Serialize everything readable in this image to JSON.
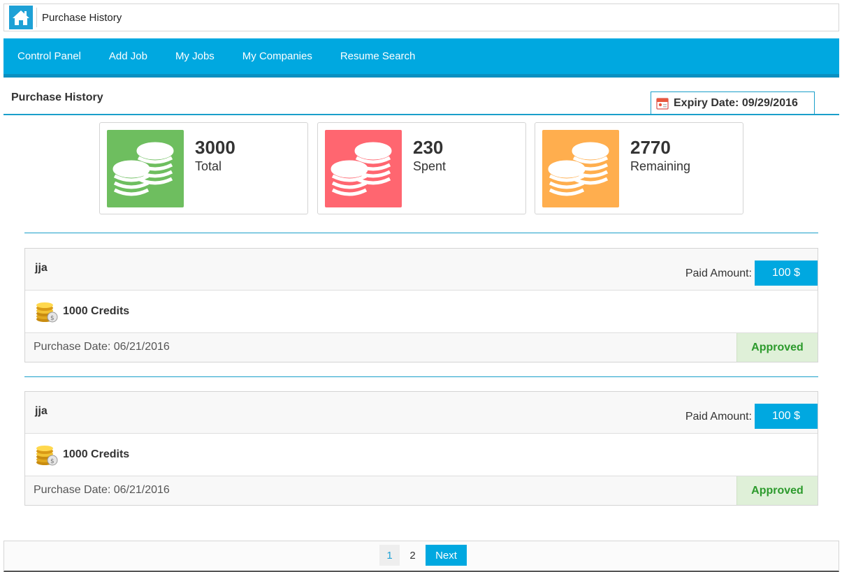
{
  "breadcrumb": {
    "home_icon": "home-icon",
    "current": "Purchase History"
  },
  "nav": {
    "items": [
      "Control Panel",
      "Add Job",
      "My Jobs",
      "My Companies",
      "Resume Search"
    ]
  },
  "page": {
    "title": "Purchase History",
    "expiry": "Expiry Date: 09/29/2016",
    "expiry_icon": "calendar-icon"
  },
  "stats": [
    {
      "value": "3000",
      "label": "Total",
      "color": "#6ebe5f",
      "icon": "coins-icon"
    },
    {
      "value": "230",
      "label": "Spent",
      "color": "#ff6670",
      "icon": "coins-icon"
    },
    {
      "value": "2770",
      "label": "Remaining",
      "color": "#ffae4e",
      "icon": "coins-icon"
    }
  ],
  "purchases": [
    {
      "name": "jja",
      "paid_label": "Paid Amount:",
      "paid_value": "100 $",
      "credits": "1000 Credits",
      "date": "Purchase Date: 06/21/2016",
      "status": "Approved"
    },
    {
      "name": "jja",
      "paid_label": "Paid Amount:",
      "paid_value": "100 $",
      "credits": "1000 Credits",
      "date": "Purchase Date: 06/21/2016",
      "status": "Approved"
    }
  ],
  "pagination": {
    "pages": [
      "1",
      "2"
    ],
    "next": "Next",
    "current": "1"
  }
}
